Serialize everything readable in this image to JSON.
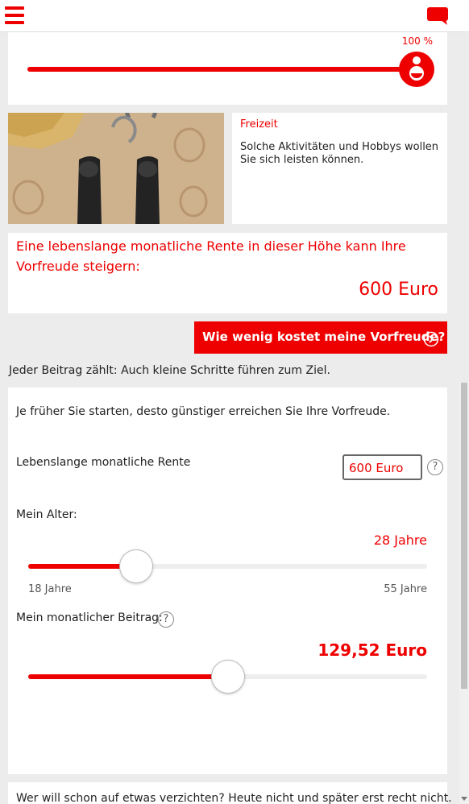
{
  "header": {
    "menu_icon": "hamburger-icon",
    "chat_icon": "chat-bubble-icon",
    "accent": "#e00000"
  },
  "top_slider": {
    "percent_label": "100 %",
    "value": 1.0
  },
  "leisure": {
    "title": "Freizeit",
    "text": "Solche Aktivitäten und Hobbys wollen Sie sich leisten können."
  },
  "pension": {
    "text": "Eine lebenslange monatliche Rente in dieser Höhe kann Ihre Vorfreude steigern:",
    "amount": "600 Euro"
  },
  "cta": {
    "label": "Wie wenig kostet meine Vorfreude?"
  },
  "note": "Jeder Beitrag zählt: Auch kleine Schritte führen zum Ziel.",
  "calculator": {
    "intro": "Je früher Sie starten, desto günstiger erreichen Sie Ihre Vorfreude.",
    "rente_label": "Lebenslange monatliche Rente",
    "rente_value": "600 Euro",
    "help": "?",
    "age_label": "Mein Alter:",
    "age_value": "28 Jahre",
    "age_min": "18 Jahre",
    "age_max": "55 Jahre",
    "age_fraction": 0.27,
    "beitrag_label": "Mein monatlicher Beitrag:",
    "beitrag_value": "129,52 Euro",
    "beitrag_fraction": 0.5
  },
  "bottom": {
    "text": "Wer will schon auf etwas verzichten? Heute nicht und später erst recht nicht."
  }
}
